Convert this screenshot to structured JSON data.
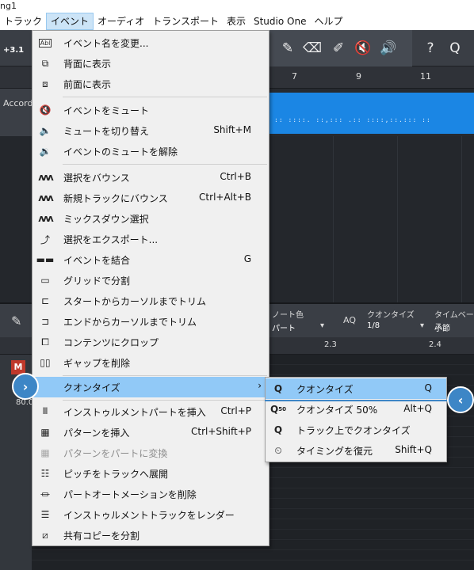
{
  "window": {
    "title": "ng1"
  },
  "menubar": {
    "items": [
      "トラック",
      "イベント",
      "オーディオ",
      "トランスポート",
      "表示",
      "Studio One",
      "ヘルプ"
    ],
    "active": "イベント"
  },
  "toolbar": {
    "left_value": "+3.1"
  },
  "ruler": {
    "ticks": [
      "7",
      "9",
      "11"
    ]
  },
  "track": {
    "name": "Accord"
  },
  "editor": {
    "note_color_label": "ノート色",
    "note_color_value": "パート",
    "aq_label": "AQ",
    "quantize_label": "クオンタイズ",
    "quantize_value": "1/8",
    "timebase_label": "タイムベース",
    "timebase_value": "小節",
    "ruler_ticks": [
      "2.3",
      "2.4"
    ],
    "mute_label": "M",
    "left_value": "80.0"
  },
  "event_menu": {
    "items": [
      {
        "icon": "abl-rename-icon",
        "label": "イベント名を変更...",
        "shortcut": ""
      },
      {
        "icon": "send-to-back-icon",
        "label": "背面に表示",
        "shortcut": ""
      },
      {
        "icon": "bring-to-front-icon",
        "label": "前面に表示",
        "shortcut": ""
      },
      {
        "icon": "mute-event-icon",
        "label": "イベントをミュート",
        "shortcut": ""
      },
      {
        "icon": "toggle-mute-icon",
        "label": "ミュートを切り替え",
        "shortcut": "Shift+M"
      },
      {
        "icon": "unmute-event-icon",
        "label": "イベントのミュートを解除",
        "shortcut": ""
      },
      {
        "icon": "bounce-icon",
        "label": "選択をバウンス",
        "shortcut": "Ctrl+B"
      },
      {
        "icon": "bounce-new-track-icon",
        "label": "新規トラックにバウンス",
        "shortcut": "Ctrl+Alt+B"
      },
      {
        "icon": "mixdown-icon",
        "label": "ミックスダウン選択",
        "shortcut": ""
      },
      {
        "icon": "export-icon",
        "label": "選択をエクスポート...",
        "shortcut": ""
      },
      {
        "icon": "merge-icon",
        "label": "イベントを結合",
        "shortcut": "G"
      },
      {
        "icon": "split-grid-icon",
        "label": "グリッドで分割",
        "shortcut": ""
      },
      {
        "icon": "trim-start-icon",
        "label": "スタートからカーソルまでトリム",
        "shortcut": ""
      },
      {
        "icon": "trim-end-icon",
        "label": "エンドからカーソルまでトリム",
        "shortcut": ""
      },
      {
        "icon": "crop-icon",
        "label": "コンテンツにクロップ",
        "shortcut": ""
      },
      {
        "icon": "delete-gaps-icon",
        "label": "ギャップを削除",
        "shortcut": ""
      },
      {
        "icon": "",
        "label": "クオンタイズ",
        "shortcut": ""
      },
      {
        "icon": "piano-icon",
        "label": "インストゥルメントパートを挿入",
        "shortcut": "Ctrl+P"
      },
      {
        "icon": "pattern-icon",
        "label": "パターンを挿入",
        "shortcut": "Ctrl+Shift+P"
      },
      {
        "icon": "pattern-convert-icon",
        "label": "パターンをパートに変換",
        "shortcut": ""
      },
      {
        "icon": "pitch-expand-icon",
        "label": "ピッチをトラックへ展開",
        "shortcut": ""
      },
      {
        "icon": "delete-automation-icon",
        "label": "パートオートメーションを削除",
        "shortcut": ""
      },
      {
        "icon": "render-icon",
        "label": "インストゥルメントトラックをレンダー",
        "shortcut": ""
      },
      {
        "icon": "split-copy-icon",
        "label": "共有コピーを分割",
        "shortcut": ""
      }
    ]
  },
  "quantize_submenu": {
    "items": [
      {
        "icon": "quantize-icon",
        "label": "クオンタイズ",
        "shortcut": "Q"
      },
      {
        "icon": "quantize-50-icon",
        "label": "クオンタイズ 50%",
        "shortcut": "Alt+Q"
      },
      {
        "icon": "quantize-track-icon",
        "label": "トラック上でクオンタイズ",
        "shortcut": ""
      },
      {
        "icon": "restore-timing-icon",
        "label": "タイミングを復元",
        "shortcut": "Shift+Q"
      }
    ]
  },
  "accent_color": "#91c9f7",
  "callout_color": "#3d86c6"
}
